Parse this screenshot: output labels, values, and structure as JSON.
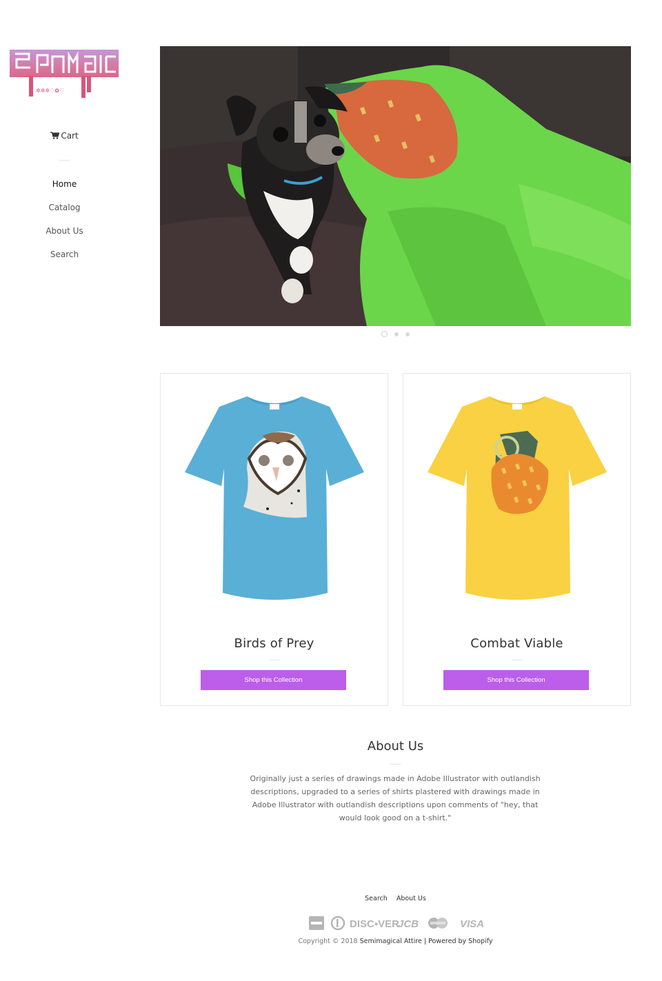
{
  "brand": {
    "logo_alt": "Semimagical Attire"
  },
  "sidebar": {
    "cart_label": "Cart",
    "nav": [
      {
        "label": "Home",
        "active": true
      },
      {
        "label": "Catalog",
        "active": false
      },
      {
        "label": "About Us",
        "active": false
      },
      {
        "label": "Search",
        "active": false
      }
    ]
  },
  "slider": {
    "slide_count": 3,
    "current_slide": 1
  },
  "collections": [
    {
      "title": "Birds of Prey",
      "button_label": "Shop this Collection",
      "shirt_color": "#5aafd6"
    },
    {
      "title": "Combat Viable",
      "button_label": "Shop this Collection",
      "shirt_color": "#f9d142"
    }
  ],
  "about": {
    "title": "About Us",
    "text": "Originally just a series of drawings made in Adobe Illustrator with outlandish descriptions, upgraded to a series of shirts plastered with drawings made in Adobe Illustrator with outlandish descriptions upon comments of \"hey, that would look good on a t-shirt.\""
  },
  "footer": {
    "links": [
      "Search",
      "About Us"
    ],
    "payment_icons": [
      "american-express",
      "diners-club",
      "discover",
      "jcb",
      "master",
      "visa"
    ],
    "payment_labels": {
      "discover": "DISC▪VER",
      "jcb": "JCB",
      "visa": "VISA"
    },
    "copyright_prefix": "Copyright © 2018",
    "store_name": "Semimagical Attire",
    "separator": "|",
    "powered_by": "Powered by Shopify"
  },
  "colors": {
    "accent_button": "#bc5ee9",
    "logo_pink": "#d8567a",
    "logo_purple": "#b487c9"
  }
}
